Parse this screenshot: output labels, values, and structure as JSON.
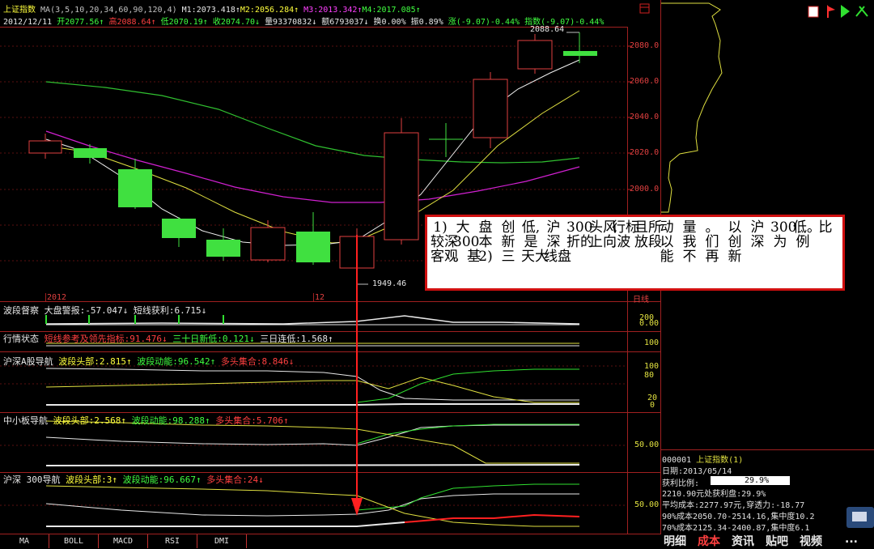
{
  "header": {
    "index_name": "上证指数",
    "ma_params": "MA(3,5,10,20,34,60,90,120,4)",
    "m1": "M1:2073.418↑",
    "m2": "M2:2056.284↑",
    "m3": "M3:2013.342↑",
    "m4": "M4:2017.085↑",
    "date": "2012/12/11",
    "open": "开2077.56↑",
    "high": "高2088.64↑",
    "low": "低2070.19↑",
    "close": "收2074.70↓",
    "volume": "量93370832↓",
    "amount": "额6793037↓",
    "turnover": "换0.00%",
    "amplitude": "振0.89%",
    "change": "涨(-9.07)-0.44%",
    "index_change": "指数(-9.07)-0.44%"
  },
  "main_chart": {
    "high_label": "2088.64",
    "low_label": "1949.46",
    "year_label": "2012",
    "month_label": "12",
    "period_label": "日线",
    "y_ticks": [
      "2080.0",
      "2060.0",
      "2040.0",
      "2020.0",
      "2000.0"
    ]
  },
  "panels": [
    {
      "name": "波段督察",
      "items": [
        {
          "text": "大盘警报:-57.047↓",
          "color": "#e8e8e8"
        },
        {
          "text": "短线获利:6.715↓",
          "color": "#e8e8e8"
        }
      ],
      "ticks": [
        "200",
        "0.00"
      ]
    },
    {
      "name": "行情状态",
      "items": [
        {
          "text": "短线参考及领先指标:91.476↓",
          "color": "#ff4040"
        },
        {
          "text": "三十日新低:0.121↓",
          "color": "#40ff40"
        },
        {
          "text": "三日连低:1.568↑",
          "color": "#e8e8e8"
        }
      ],
      "ticks": [
        "100"
      ]
    },
    {
      "name": "沪深A股导航",
      "items": [
        {
          "text": "波段头部:2.815↑",
          "color": "#ffff3c"
        },
        {
          "text": "波段动能:96.542↑",
          "color": "#40ff40"
        },
        {
          "text": "多头集合:8.846↓",
          "color": "#ff4040"
        }
      ],
      "ticks": [
        "100",
        "80",
        "20",
        "0"
      ]
    },
    {
      "name": "中小板导航",
      "items": [
        {
          "text": "波段头部:2.568↑",
          "color": "#ffff3c"
        },
        {
          "text": "波段动能:98.288↑",
          "color": "#40ff40"
        },
        {
          "text": "多头集合:5.706↑",
          "color": "#ff4040"
        }
      ],
      "ticks": [
        "50.00"
      ]
    },
    {
      "name": "沪深 300导航",
      "items": [
        {
          "text": "波段头部:3↑",
          "color": "#ffff3c"
        },
        {
          "text": "波段动能:96.667↑",
          "color": "#40ff40"
        },
        {
          "text": "多头集合:24↓",
          "color": "#ff4040"
        }
      ],
      "ticks": [
        "50.00"
      ]
    }
  ],
  "bottom_tabs": [
    "MA",
    "BOLL",
    "MACD",
    "RSI",
    "DMI"
  ],
  "info_panel": {
    "code_line": "000001",
    "name_line": "上证指数(1)",
    "date": "日期:2013/05/14",
    "profit_label": "获利比例:",
    "profit_value": "29.9%",
    "line1": "2210.90元处获利盘:29.9%",
    "line2": "平均成本:2277.97元,穿透力:-18.77",
    "line3": "90%成本2050.70-2514.16,集中度10.2",
    "line4": "70%成本2125.34-2400.87,集中度6.1"
  },
  "right_tabs": [
    "明细",
    "成本",
    "资讯",
    "贴吧",
    "视频",
    "..."
  ],
  "note": {
    "columns": [
      "1)\n较深\n客观",
      "大\n300\n。基",
      "盘\n本\n2)",
      "创\n新\n三",
      "低,\n是\n天大",
      "沪\n深\n线盘",
      "300\n折的",
      "头风\n上向",
      "行标\n,波",
      "且所\n放段",
      "动\n以\n能",
      "量\n我\n不",
      "。\n们\n再",
      "以\n创\n新",
      "沪\n深",
      "300\n为",
      "低。\n例",
      "比"
    ]
  }
}
